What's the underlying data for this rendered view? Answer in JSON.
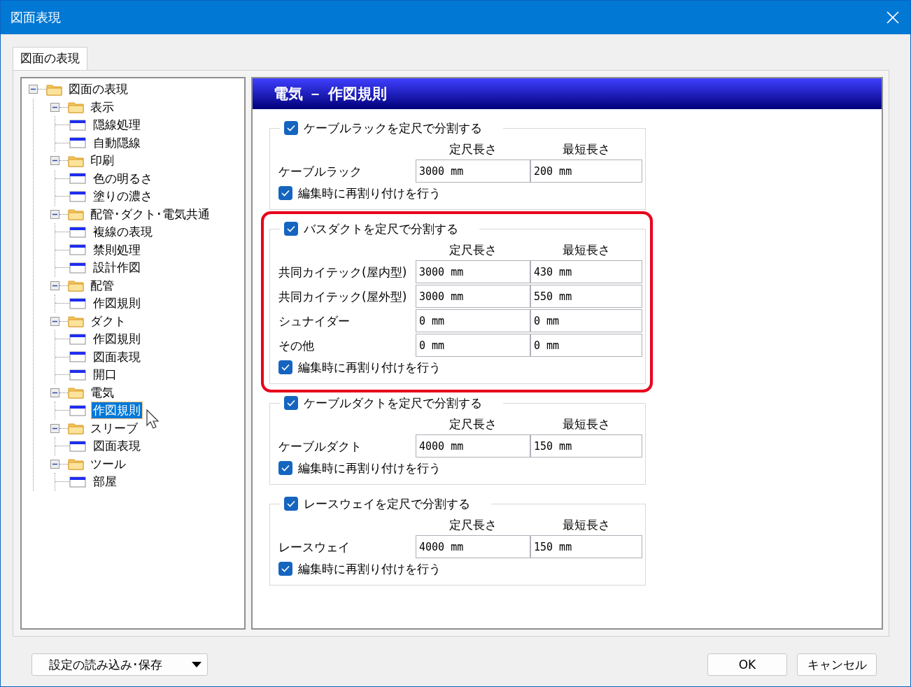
{
  "window": {
    "title": "図面表現"
  },
  "tabs": [
    {
      "label": "図面の表現",
      "selected": true
    }
  ],
  "tree": [
    {
      "label": "図面の表現",
      "kind": "folder",
      "expanded": true,
      "selected": false,
      "children": [
        {
          "label": "表示",
          "kind": "folder",
          "expanded": true,
          "selected": false,
          "children": [
            {
              "label": "隠線処理",
              "kind": "page",
              "selected": false
            },
            {
              "label": "自動隠線",
              "kind": "page",
              "selected": false
            }
          ]
        },
        {
          "label": "印刷",
          "kind": "folder",
          "expanded": true,
          "selected": false,
          "children": [
            {
              "label": "色の明るさ",
              "kind": "page",
              "selected": false
            },
            {
              "label": "塗りの濃さ",
              "kind": "page",
              "selected": false
            }
          ]
        },
        {
          "label": "配管･ダクト･電気共通",
          "kind": "folder",
          "expanded": true,
          "selected": false,
          "children": [
            {
              "label": "複線の表現",
              "kind": "page",
              "selected": false
            },
            {
              "label": "禁則処理",
              "kind": "page",
              "selected": false
            },
            {
              "label": "設計作図",
              "kind": "page",
              "selected": false
            }
          ]
        },
        {
          "label": "配管",
          "kind": "folder",
          "expanded": true,
          "selected": false,
          "children": [
            {
              "label": "作図規則",
              "kind": "page",
              "selected": false
            }
          ]
        },
        {
          "label": "ダクト",
          "kind": "folder",
          "expanded": true,
          "selected": false,
          "children": [
            {
              "label": "作図規則",
              "kind": "page",
              "selected": false
            },
            {
              "label": "図面表現",
              "kind": "page",
              "selected": false
            },
            {
              "label": "開口",
              "kind": "page",
              "selected": false
            }
          ]
        },
        {
          "label": "電気",
          "kind": "folder",
          "expanded": true,
          "selected": false,
          "children": [
            {
              "label": "作図規則",
              "kind": "page",
              "selected": true
            }
          ]
        },
        {
          "label": "スリーブ",
          "kind": "folder",
          "expanded": true,
          "selected": false,
          "children": [
            {
              "label": "図面表現",
              "kind": "page",
              "selected": false
            }
          ]
        },
        {
          "label": "ツール",
          "kind": "folder",
          "expanded": true,
          "selected": false,
          "children": [
            {
              "label": "部屋",
              "kind": "page",
              "selected": false
            }
          ]
        }
      ]
    }
  ],
  "panel": {
    "title": "電気 － 作図規則",
    "groups": [
      {
        "label": "ケーブルラックを定尺で分割する",
        "checked": true,
        "highlighted": false,
        "col_1": "定尺長さ",
        "col_2": "最短長さ",
        "rows": [
          {
            "label": "ケーブルラック",
            "standard": "3000 mm",
            "minimum": "200 mm"
          }
        ],
        "reassign": {
          "label": "編集時に再割り付けを行う",
          "checked": true
        }
      },
      {
        "label": "バスダクトを定尺で分割する",
        "checked": true,
        "highlighted": true,
        "col_1": "定尺長さ",
        "col_2": "最短長さ",
        "rows": [
          {
            "label": "共同カイテック(屋内型)",
            "standard": "3000 mm",
            "minimum": "430 mm"
          },
          {
            "label": "共同カイテック(屋外型)",
            "standard": "3000 mm",
            "minimum": "550 mm"
          },
          {
            "label": "シュナイダー",
            "standard": "0 mm",
            "minimum": "0 mm"
          },
          {
            "label": "その他",
            "standard": "0 mm",
            "minimum": "0 mm"
          }
        ],
        "reassign": {
          "label": "編集時に再割り付けを行う",
          "checked": true
        }
      },
      {
        "label": "ケーブルダクトを定尺で分割する",
        "checked": true,
        "highlighted": false,
        "col_1": "定尺長さ",
        "col_2": "最短長さ",
        "rows": [
          {
            "label": "ケーブルダクト",
            "standard": "4000 mm",
            "minimum": "150 mm"
          }
        ],
        "reassign": {
          "label": "編集時に再割り付けを行う",
          "checked": true
        }
      },
      {
        "label": "レースウェイを定尺で分割する",
        "checked": true,
        "highlighted": false,
        "col_1": "定尺長さ",
        "col_2": "最短長さ",
        "rows": [
          {
            "label": "レースウェイ",
            "standard": "4000 mm",
            "minimum": "150 mm"
          }
        ],
        "reassign": {
          "label": "編集時に再割り付けを行う",
          "checked": true
        }
      }
    ]
  },
  "buttons": {
    "settings": "設定の読み込み･保存",
    "ok": "OK",
    "cancel": "キャンセル"
  }
}
